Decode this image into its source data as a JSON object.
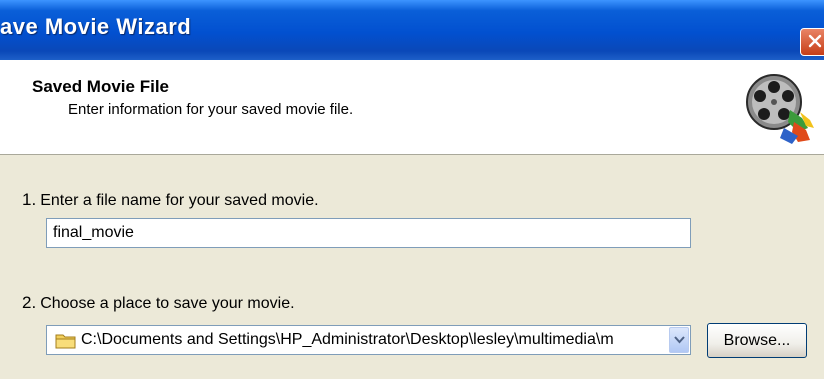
{
  "window": {
    "title": "ave Movie Wizard"
  },
  "header": {
    "title": "Saved Movie File",
    "subtitle": "Enter information for your saved movie file."
  },
  "steps": [
    {
      "number": "1.",
      "label": "Enter a file name for your saved movie."
    },
    {
      "number": "2.",
      "label": "Choose a place to save your movie."
    }
  ],
  "file_name": {
    "value": "final_movie"
  },
  "location": {
    "value": "C:\\Documents and Settings\\HP_Administrator\\Desktop\\lesley\\multimedia\\m"
  },
  "buttons": {
    "browse": "Browse..."
  },
  "icons": {
    "close": "close-icon",
    "film": "film-reel-icon",
    "folder": "folder-icon",
    "dropdown": "chevron-down-icon"
  },
  "colors": {
    "titlebar": "#0250d0",
    "close_button": "#c73e17",
    "dialog_background": "#ece9d8"
  }
}
